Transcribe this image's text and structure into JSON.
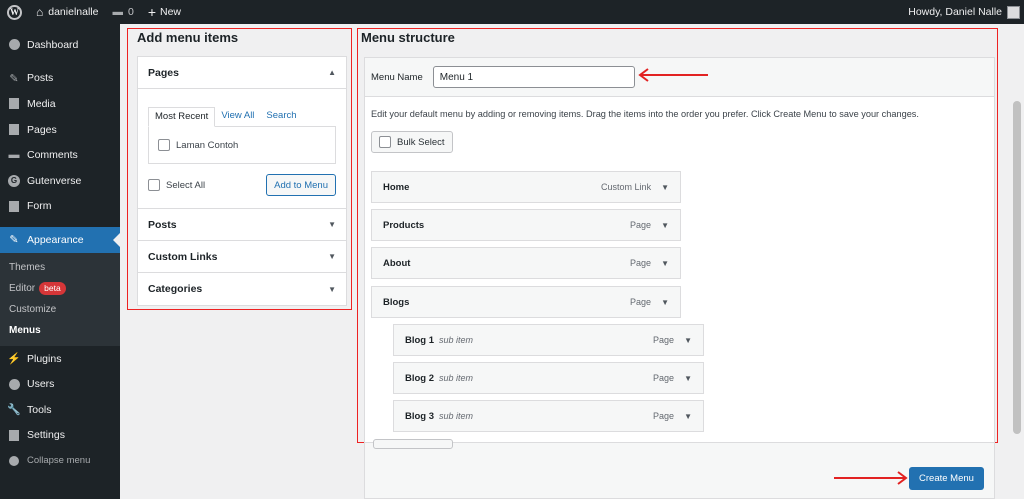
{
  "adminbar": {
    "site_name": "danielnalle",
    "comments_count": "0",
    "new_label": "New",
    "greeting": "Howdy, Daniel Nalle"
  },
  "sidebar": {
    "items": [
      {
        "label": "Dashboard",
        "icon": "dashboard-icon"
      },
      {
        "label": "Posts",
        "icon": "pin-icon"
      },
      {
        "label": "Media",
        "icon": "media-icon"
      },
      {
        "label": "Pages",
        "icon": "pages-icon"
      },
      {
        "label": "Comments",
        "icon": "comment-icon"
      },
      {
        "label": "Gutenverse",
        "icon": "gutenverse-icon"
      },
      {
        "label": "Form",
        "icon": "form-icon"
      },
      {
        "label": "Appearance",
        "icon": "brush-icon"
      }
    ],
    "submenu": {
      "themes": "Themes",
      "editor": "Editor",
      "editor_badge": "beta",
      "customize": "Customize",
      "menus": "Menus"
    },
    "items_after": [
      {
        "label": "Plugins",
        "icon": "plugin-icon"
      },
      {
        "label": "Users",
        "icon": "users-icon"
      },
      {
        "label": "Tools",
        "icon": "tools-icon"
      },
      {
        "label": "Settings",
        "icon": "settings-icon"
      }
    ],
    "collapse_label": "Collapse menu"
  },
  "add_items": {
    "title": "Add menu items",
    "pages_label": "Pages",
    "tabs": [
      "Most Recent",
      "View All",
      "Search"
    ],
    "page_option": "Laman Contoh",
    "select_all": "Select All",
    "add_button": "Add to Menu",
    "sections": [
      "Posts",
      "Custom Links",
      "Categories"
    ]
  },
  "structure": {
    "title": "Menu structure",
    "menu_name_label": "Menu Name",
    "menu_name_value": "Menu 1",
    "instructions": "Edit your default menu by adding or removing items. Drag the items into the order you prefer. Click Create Menu to save your changes.",
    "bulk_select": "Bulk Select",
    "items": [
      {
        "title": "Home",
        "type": "Custom Link",
        "sub": ""
      },
      {
        "title": "Products",
        "type": "Page",
        "sub": ""
      },
      {
        "title": "About",
        "type": "Page",
        "sub": ""
      },
      {
        "title": "Blogs",
        "type": "Page",
        "sub": ""
      },
      {
        "title": "Blog 1",
        "type": "Page",
        "sub": "sub item"
      },
      {
        "title": "Blog 2",
        "type": "Page",
        "sub": "sub item"
      },
      {
        "title": "Blog 3",
        "type": "Page",
        "sub": "sub item"
      }
    ],
    "create_button": "Create Menu"
  },
  "colors": {
    "accent": "#2271b1",
    "annotation": "#e22222",
    "admin_bg": "#1d2327"
  }
}
